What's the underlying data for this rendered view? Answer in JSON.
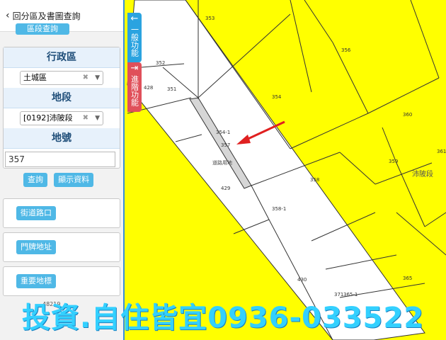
{
  "panel": {
    "back_title": "回分區及書圖查詢",
    "top_button": "區段查詢",
    "district_title": "行政區",
    "district_value": "土城區",
    "section_title": "地段",
    "section_value": "[0192]沛陂段",
    "lot_title": "地號",
    "lot_value": "357",
    "query_button": "查詢",
    "show_button": "顯示資料",
    "street_button": "街道路口",
    "address_button": "門牌地址",
    "landmark_button": "重要地標"
  },
  "tabs": {
    "general": "一般功能",
    "advanced": "進階功能"
  },
  "map": {
    "parcels": [
      "353",
      "356",
      "352",
      "351",
      "428",
      "354",
      "360",
      "354-1",
      "357",
      "359",
      "361",
      "358",
      "429",
      "358-1",
      "430",
      "371",
      "365-1",
      "365"
    ],
    "section_label": "沛陂段",
    "road_label": "道路用地",
    "scale_text": "48219"
  },
  "watermark": "投資.自住皆宜0936-033522"
}
